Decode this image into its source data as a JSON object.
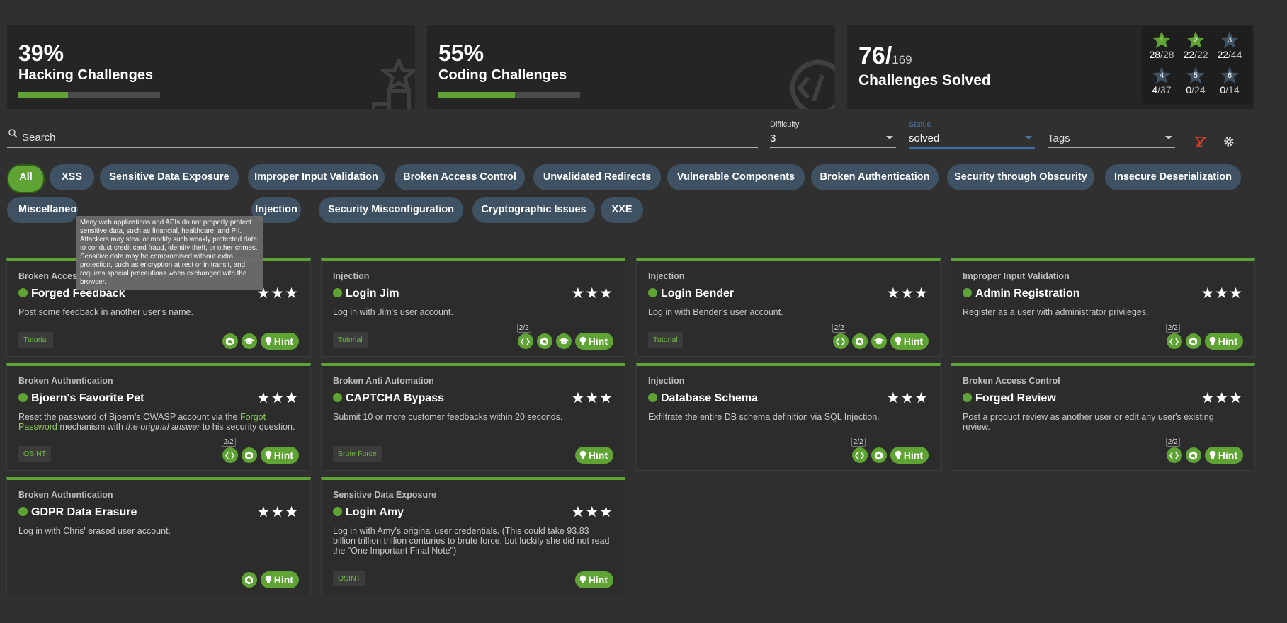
{
  "stats": {
    "hacking": {
      "percent": "39%",
      "label": "Hacking Challenges",
      "progress": 0.39
    },
    "coding": {
      "percent": "55%",
      "label": "Coding Challenges",
      "progress": 0.55
    },
    "solved": {
      "count": "76/",
      "total": "169",
      "label": "Challenges Solved"
    },
    "difficulty_stars": [
      {
        "level": "1",
        "solved": "28",
        "total": "/28",
        "color": "#5ea334"
      },
      {
        "level": "2",
        "solved": "22",
        "total": "/22",
        "color": "#5ea334"
      },
      {
        "level": "3",
        "solved": "22",
        "total": "/44",
        "color": "#3e5263"
      },
      {
        "level": "4",
        "solved": "4",
        "total": "/37",
        "color": "#3e5263"
      },
      {
        "level": "5",
        "solved": "0",
        "total": "/24",
        "color": "#3e5263"
      },
      {
        "level": "6",
        "solved": "0",
        "total": "/14",
        "color": "#3e5263"
      }
    ]
  },
  "filters": {
    "search_placeholder": "Search",
    "difficulty": {
      "label": "Difficulty",
      "value": "3"
    },
    "status": {
      "label": "Status",
      "value": "solved"
    },
    "tags": {
      "label": "Tags"
    }
  },
  "categories": [
    "All",
    "XSS",
    "Sensitive Data Exposure",
    "Improper Input Validation",
    "Broken Access Control",
    "Unvalidated Redirects",
    "Vulnerable Components",
    "Broken Authentication",
    "Security through Obscurity",
    "Insecure Deserialization",
    "Miscellaneo",
    "Injection",
    "Security Misconfiguration",
    "Cryptographic Issues",
    "XXE"
  ],
  "tooltip": "Many web applications and APIs do not properly protect sensitive data, such as financial, healthcare, and PII. Attackers may steal or modify such weakly protected data to conduct credit card fraud, identity theft, or other crimes. Sensitive data may be compromised without extra protection, such as encryption at rest or in transit, and requires special precautions when exchanged with the browser.",
  "challenges": [
    {
      "category": "Broken Acces",
      "title": "Forged Feedback",
      "stars": "★★★",
      "desc": "Post some feedback in another user's name.",
      "tag": "Tutorial",
      "hint": "Hint"
    },
    {
      "category": "Injection",
      "title": "Login Jim",
      "stars": "★★★",
      "desc": "Log in with Jim's user account.",
      "tag": "Tutorial",
      "code_count": "2/2",
      "hint": "Hint"
    },
    {
      "category": "Injection",
      "title": "Login Bender",
      "stars": "★★★",
      "desc": "Log in with Bender's user account.",
      "tag": "Tutorial",
      "code_count": "2/2",
      "hint": "Hint"
    },
    {
      "category": "Improper Input Validation",
      "title": "Admin Registration",
      "stars": "★★★",
      "desc": "Register as a user with administrator privileges.",
      "code_count": "2/2",
      "hint": "Hint"
    },
    {
      "category": "Broken Authentication",
      "title": "Bjoern's Favorite Pet",
      "stars": "★★★",
      "desc_pre": "Reset the password of Bjoern's OWASP account via the ",
      "desc_link": "Forgot Password",
      "desc_mid": " mechanism with ",
      "desc_em": "the original answer",
      "desc_post": " to his security question.",
      "tag": "OSINT",
      "code_count": "2/2",
      "hint": "Hint"
    },
    {
      "category": "Broken Anti Automation",
      "title": "CAPTCHA Bypass",
      "stars": "★★★",
      "desc": "Submit 10 or more customer feedbacks within 20 seconds.",
      "tag": "Brute Force",
      "hint": "Hint"
    },
    {
      "category": "Injection",
      "title": "Database Schema",
      "stars": "★★★",
      "desc": "Exfiltrate the entire DB schema definition via SQL Injection.",
      "code_count": "2/2",
      "hint": "Hint"
    },
    {
      "category": "Broken Access Control",
      "title": "Forged Review",
      "stars": "★★★",
      "desc": "Post a product review as another user or edit any user's existing review.",
      "code_count": "2/2",
      "hint": "Hint"
    },
    {
      "category": "Broken Authentication",
      "title": "GDPR Data Erasure",
      "stars": "★★★",
      "desc": "Log in with Chris' erased user account.",
      "hint": "Hint"
    },
    {
      "category": "Sensitive Data Exposure",
      "title": "Login Amy",
      "stars": "★★★",
      "desc": "Log in with Amy's original user credentials. (This could take 93.83 billion trillion trillion centuries to brute force, but luckily she did not read the \"One Important Final Note\")",
      "tag": "OSINT",
      "hint": "Hint"
    }
  ]
}
